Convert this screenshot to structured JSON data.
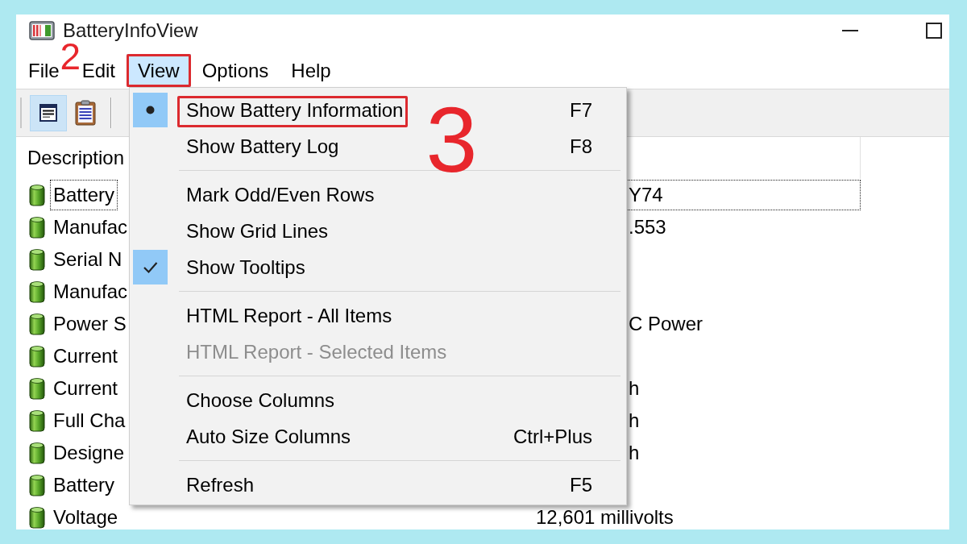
{
  "window": {
    "title": "BatteryInfoView"
  },
  "menu_bar": [
    {
      "label": "File",
      "selected": false,
      "highlighted": false
    },
    {
      "label": "Edit",
      "selected": false,
      "highlighted": false
    },
    {
      "label": "View",
      "selected": true,
      "highlighted": true,
      "step": "2"
    },
    {
      "label": "Options",
      "selected": false,
      "highlighted": false
    },
    {
      "label": "Help",
      "selected": false,
      "highlighted": false
    }
  ],
  "toolbar": [
    {
      "selected": true
    },
    {
      "selected": false
    }
  ],
  "list": {
    "columns": [
      "Description"
    ],
    "rows": [
      {
        "description": "Battery",
        "column_2": "Y74",
        "focused": true
      },
      {
        "description": "Manufac",
        "column_2": ".553",
        "focused": false
      },
      {
        "description": "Serial N",
        "focused": false
      },
      {
        "description": "Manufac",
        "focused": false
      },
      {
        "description": "Power S",
        "column_2": "C Power",
        "focused": false
      },
      {
        "description": "Current",
        "focused": false
      },
      {
        "description": "Current",
        "column_2": "h",
        "focused": false
      },
      {
        "description": "Full Cha",
        "column_2": "h",
        "focused": false
      },
      {
        "description": "Designe",
        "column_2": "h",
        "focused": false
      },
      {
        "description": "Battery",
        "focused": false
      },
      {
        "description": "Voltage",
        "column_2": "12,601 millivolts",
        "focused": false
      }
    ]
  },
  "view_menu": {
    "items": [
      {
        "kind": "radio",
        "label": "Show Battery Information",
        "shortcut": "F7",
        "selected": true,
        "disabled": false,
        "highlighted": true,
        "step": "3"
      },
      {
        "kind": "radio",
        "label": "Show Battery Log",
        "shortcut": "F8",
        "selected": false,
        "disabled": false,
        "highlighted": false
      },
      {
        "kind": "separator"
      },
      {
        "kind": "check",
        "label": "Mark Odd/Even Rows",
        "checked": false,
        "disabled": false,
        "highlighted": false
      },
      {
        "kind": "check",
        "label": "Show Grid Lines",
        "checked": false,
        "disabled": false,
        "highlighted": false
      },
      {
        "kind": "check",
        "label": "Show Tooltips",
        "checked": true,
        "disabled": false,
        "highlighted": false
      },
      {
        "kind": "separator"
      },
      {
        "kind": "command",
        "label": "HTML Report - All Items",
        "disabled": false,
        "highlighted": false
      },
      {
        "kind": "command",
        "label": "HTML Report - Selected Items",
        "disabled": true,
        "highlighted": false
      },
      {
        "kind": "separator"
      },
      {
        "kind": "command",
        "label": "Choose Columns",
        "disabled": false,
        "highlighted": false
      },
      {
        "kind": "command",
        "label": "Auto Size Columns",
        "shortcut": "Ctrl+Plus",
        "disabled": false,
        "highlighted": false
      },
      {
        "kind": "separator"
      },
      {
        "kind": "command",
        "label": "Refresh",
        "shortcut": "F5",
        "disabled": false,
        "highlighted": false
      }
    ]
  }
}
